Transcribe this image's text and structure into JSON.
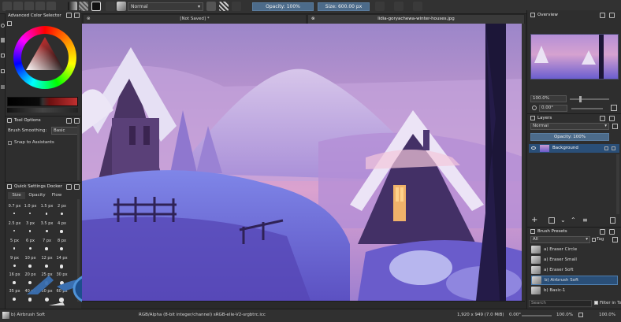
{
  "toolbar": {
    "blend_mode": "Normal",
    "opacity": "Opacity: 100%",
    "size": "Size: 600.00 px"
  },
  "tabs": [
    {
      "label": "[Not Saved] *"
    },
    {
      "label": "lidia-goryachewa-winter-houses.jpg"
    }
  ],
  "left": {
    "color_panel_title": "Advanced Color Selector",
    "tool_options_title": "Tool Options",
    "brush_smoothing_label": "Brush Smoothing:",
    "brush_smoothing_value": "Basic",
    "snap_label": "Snap to Assistants",
    "quick_settings_title": "Quick Settings Docker",
    "qs_tabs": [
      "Size",
      "Opacity",
      "Flow"
    ],
    "sizes": [
      [
        "0.7 px",
        "1.0 px",
        "1.5 px",
        "2 px"
      ],
      [
        "2.5 px",
        "3 px",
        "3.5 px",
        "4 px"
      ],
      [
        "5 px",
        "6 px",
        "7 px",
        "8 px"
      ],
      [
        "9 px",
        "10 px",
        "12 px",
        "14 px"
      ],
      [
        "16 px",
        "20 px",
        "25 px",
        "30 px"
      ],
      [
        "35 px",
        "40 px",
        "50 px",
        "60 px"
      ]
    ]
  },
  "right": {
    "overview_title": "Overview",
    "zoom": "100.0%",
    "rotation": "0.00°",
    "layers_title": "Layers",
    "layer_blend": "Normal",
    "layer_opacity": "Opacity: 100%",
    "layer_name": "Background",
    "brush_presets_title": "Brush Presets",
    "preset_filter": "All",
    "tag_label": "Tag",
    "presets": [
      "a) Eraser Circle",
      "a) Eraser Small",
      "a) Eraser Soft",
      "b) Airbrush Soft",
      "b) Basic-1"
    ],
    "search_placeholder": "Search",
    "filter_in_tag": "Filter in Tag"
  },
  "status": {
    "brush": "b) Airbrush Soft",
    "color_info": "RGB/Alpha (8-bit integer/channel)  sRGB-elle-V2-srgbtrc.icc",
    "dimensions": "1,920 x 949 (7.0 MiB)",
    "rotation": "0.00°",
    "zoom": "100.0%"
  },
  "colors": {
    "active_preset": "#2a4f78",
    "ring_accent": "#3a6fb0"
  }
}
